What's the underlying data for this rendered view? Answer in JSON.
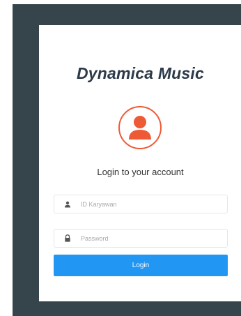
{
  "brand": {
    "name": "Dynamica Music"
  },
  "login": {
    "subtitle": "Login to your account",
    "username": {
      "value": "",
      "placeholder": "ID Karyawan"
    },
    "password": {
      "value": "",
      "placeholder": "Password"
    },
    "submit_label": "Login"
  },
  "icons": {
    "avatar": "user-avatar-icon",
    "username": "user-icon",
    "password": "lock-icon"
  },
  "colors": {
    "frame": "#36454c",
    "card": "#ffffff",
    "brand_text": "#2c3a49",
    "avatar_accent": "#ee5a36",
    "button": "#2196f3",
    "button_text": "#ffffff"
  }
}
